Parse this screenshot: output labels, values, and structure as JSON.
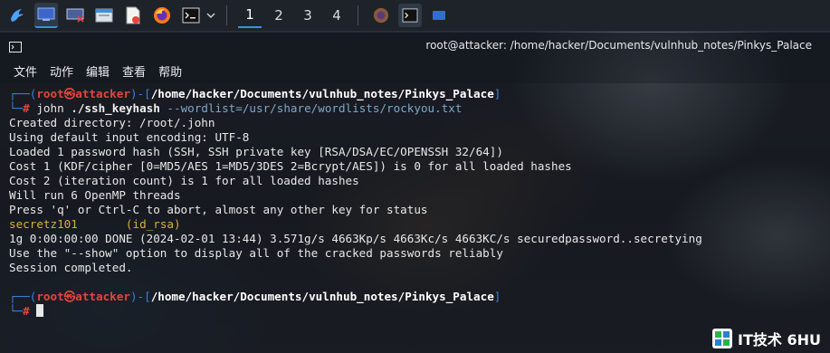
{
  "taskbar": {
    "workspaces": [
      "1",
      "2",
      "3",
      "4"
    ]
  },
  "window": {
    "title": "root@attacker: /home/hacker/Documents/vulnhub_notes/Pinkys_Palace"
  },
  "menu": {
    "items": [
      "文件",
      "动作",
      "编辑",
      "查看",
      "帮助"
    ]
  },
  "terminal": {
    "prompt1": {
      "corner": "┌──(",
      "user": "root㉿attacker",
      "mid": ")-[",
      "path": "/home/hacker/Documents/vulnhub_notes/Pinkys_Palace",
      "end": "]"
    },
    "cmd_line": {
      "corner": "└─",
      "hash": "#",
      "cmd": " john ",
      "arg": "./ssh_keyhash",
      "opt": " --wordlist=/usr/share/wordlists/rockyou.txt"
    },
    "output": [
      "Created directory: /root/.john",
      "Using default input encoding: UTF-8",
      "Loaded 1 password hash (SSH, SSH private key [RSA/DSA/EC/OPENSSH 32/64])",
      "Cost 1 (KDF/cipher [0=MD5/AES 1=MD5/3DES 2=Bcrypt/AES]) is 0 for all loaded hashes",
      "Cost 2 (iteration count) is 1 for all loaded hashes",
      "Will run 6 OpenMP threads",
      "Press 'q' or Ctrl-C to abort, almost any other key for status"
    ],
    "cracked": {
      "password": "secretz101",
      "label": "       (id_rsa)"
    },
    "output2": [
      "1g 0:00:00:00 DONE (2024-02-01 13:44) 3.571g/s 4663Kp/s 4663Kc/s 4663KC/s securedpassword..secretying",
      "Use the \"--show\" option to display all of the cracked passwords reliably",
      "Session completed."
    ],
    "prompt2": {
      "corner": "┌──(",
      "user": "root㉿attacker",
      "mid": ")-[",
      "path": "/home/hacker/Documents/vulnhub_notes/Pinkys_Palace",
      "end": "]"
    },
    "cmd_line2": {
      "corner": "└─",
      "hash": "#"
    }
  },
  "watermark": {
    "text": "IT技术 6HU"
  },
  "colors": {
    "prompt_frame": "#3a7fd9",
    "root_user": "#e5443b",
    "cracked_password": "#d8b13a",
    "option_text": "#7fa7c9",
    "accent": "#3d8fe0"
  },
  "icons": [
    "kali-dragon-icon",
    "show-desktop-icon",
    "display-settings-icon",
    "file-manager-icon",
    "text-editor-icon",
    "firefox-icon",
    "terminal-icon",
    "chevron-down-icon"
  ]
}
